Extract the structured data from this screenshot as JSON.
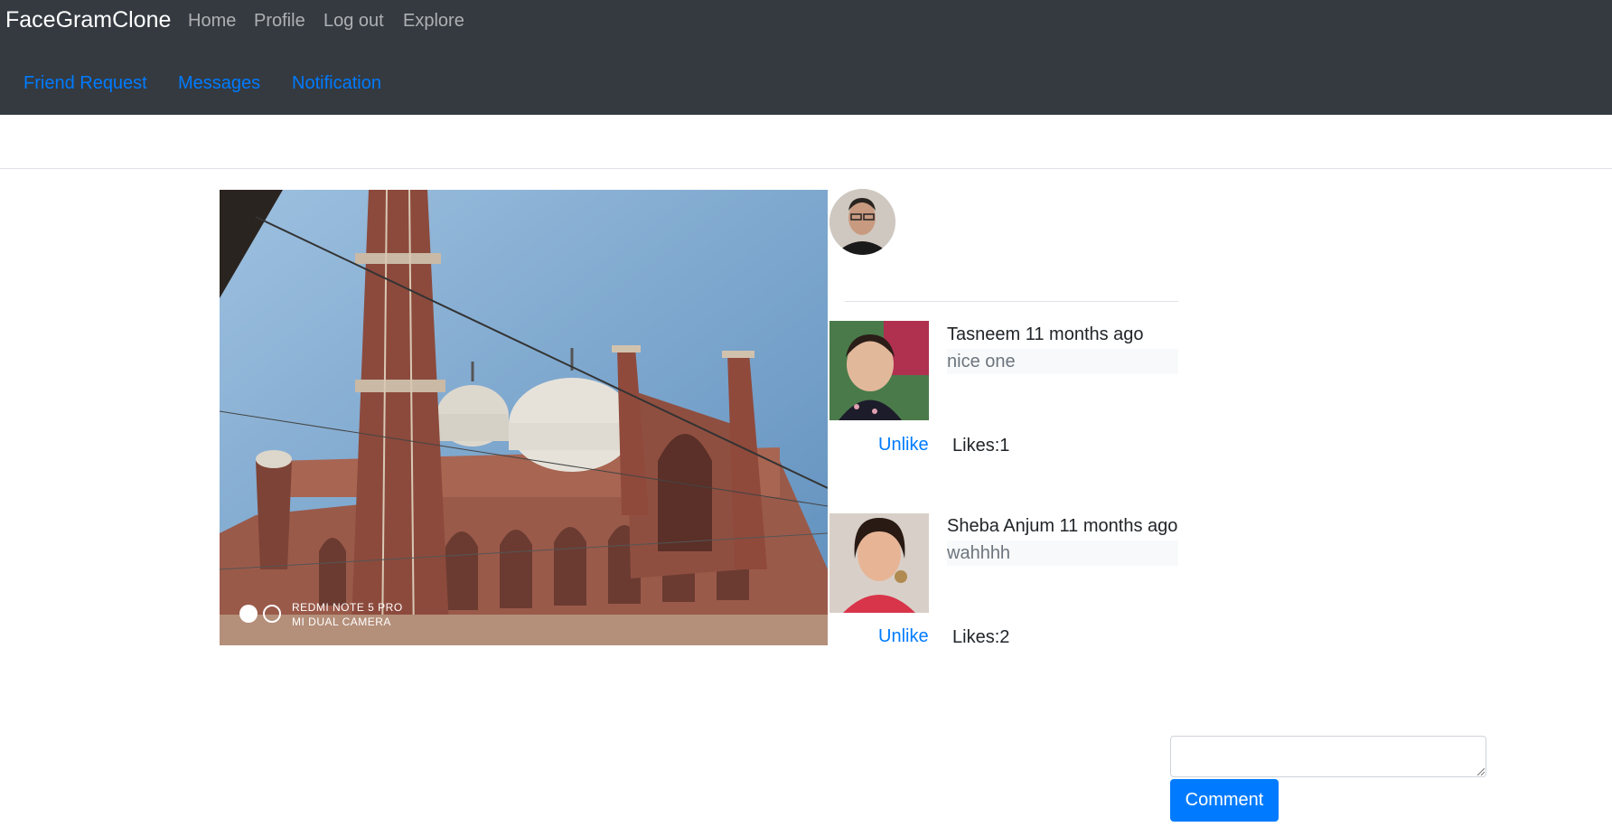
{
  "navbar": {
    "brand": "FaceGramClone",
    "links": [
      "Home",
      "Profile",
      "Log out",
      "Explore"
    ],
    "secondary_links": [
      "Friend Request",
      "Messages",
      "Notification"
    ]
  },
  "post": {
    "photo_watermark": [
      "REDMI NOTE 5 PRO",
      "MI DUAL CAMERA"
    ],
    "comments": [
      {
        "author": "Tasneem",
        "time": "11 months ago",
        "text": "nice one",
        "action": "Unlike",
        "likes": "Likes:1"
      },
      {
        "author": "Sheba Anjum",
        "time": "11 months ago",
        "text": "wahhhh",
        "action": "Unlike",
        "likes": "Likes:2"
      }
    ]
  },
  "comment_form": {
    "input_value": "",
    "button_label": "Comment"
  },
  "colors": {
    "navbar_bg": "#343a40",
    "link": "#007bff",
    "button": "#007bff"
  }
}
